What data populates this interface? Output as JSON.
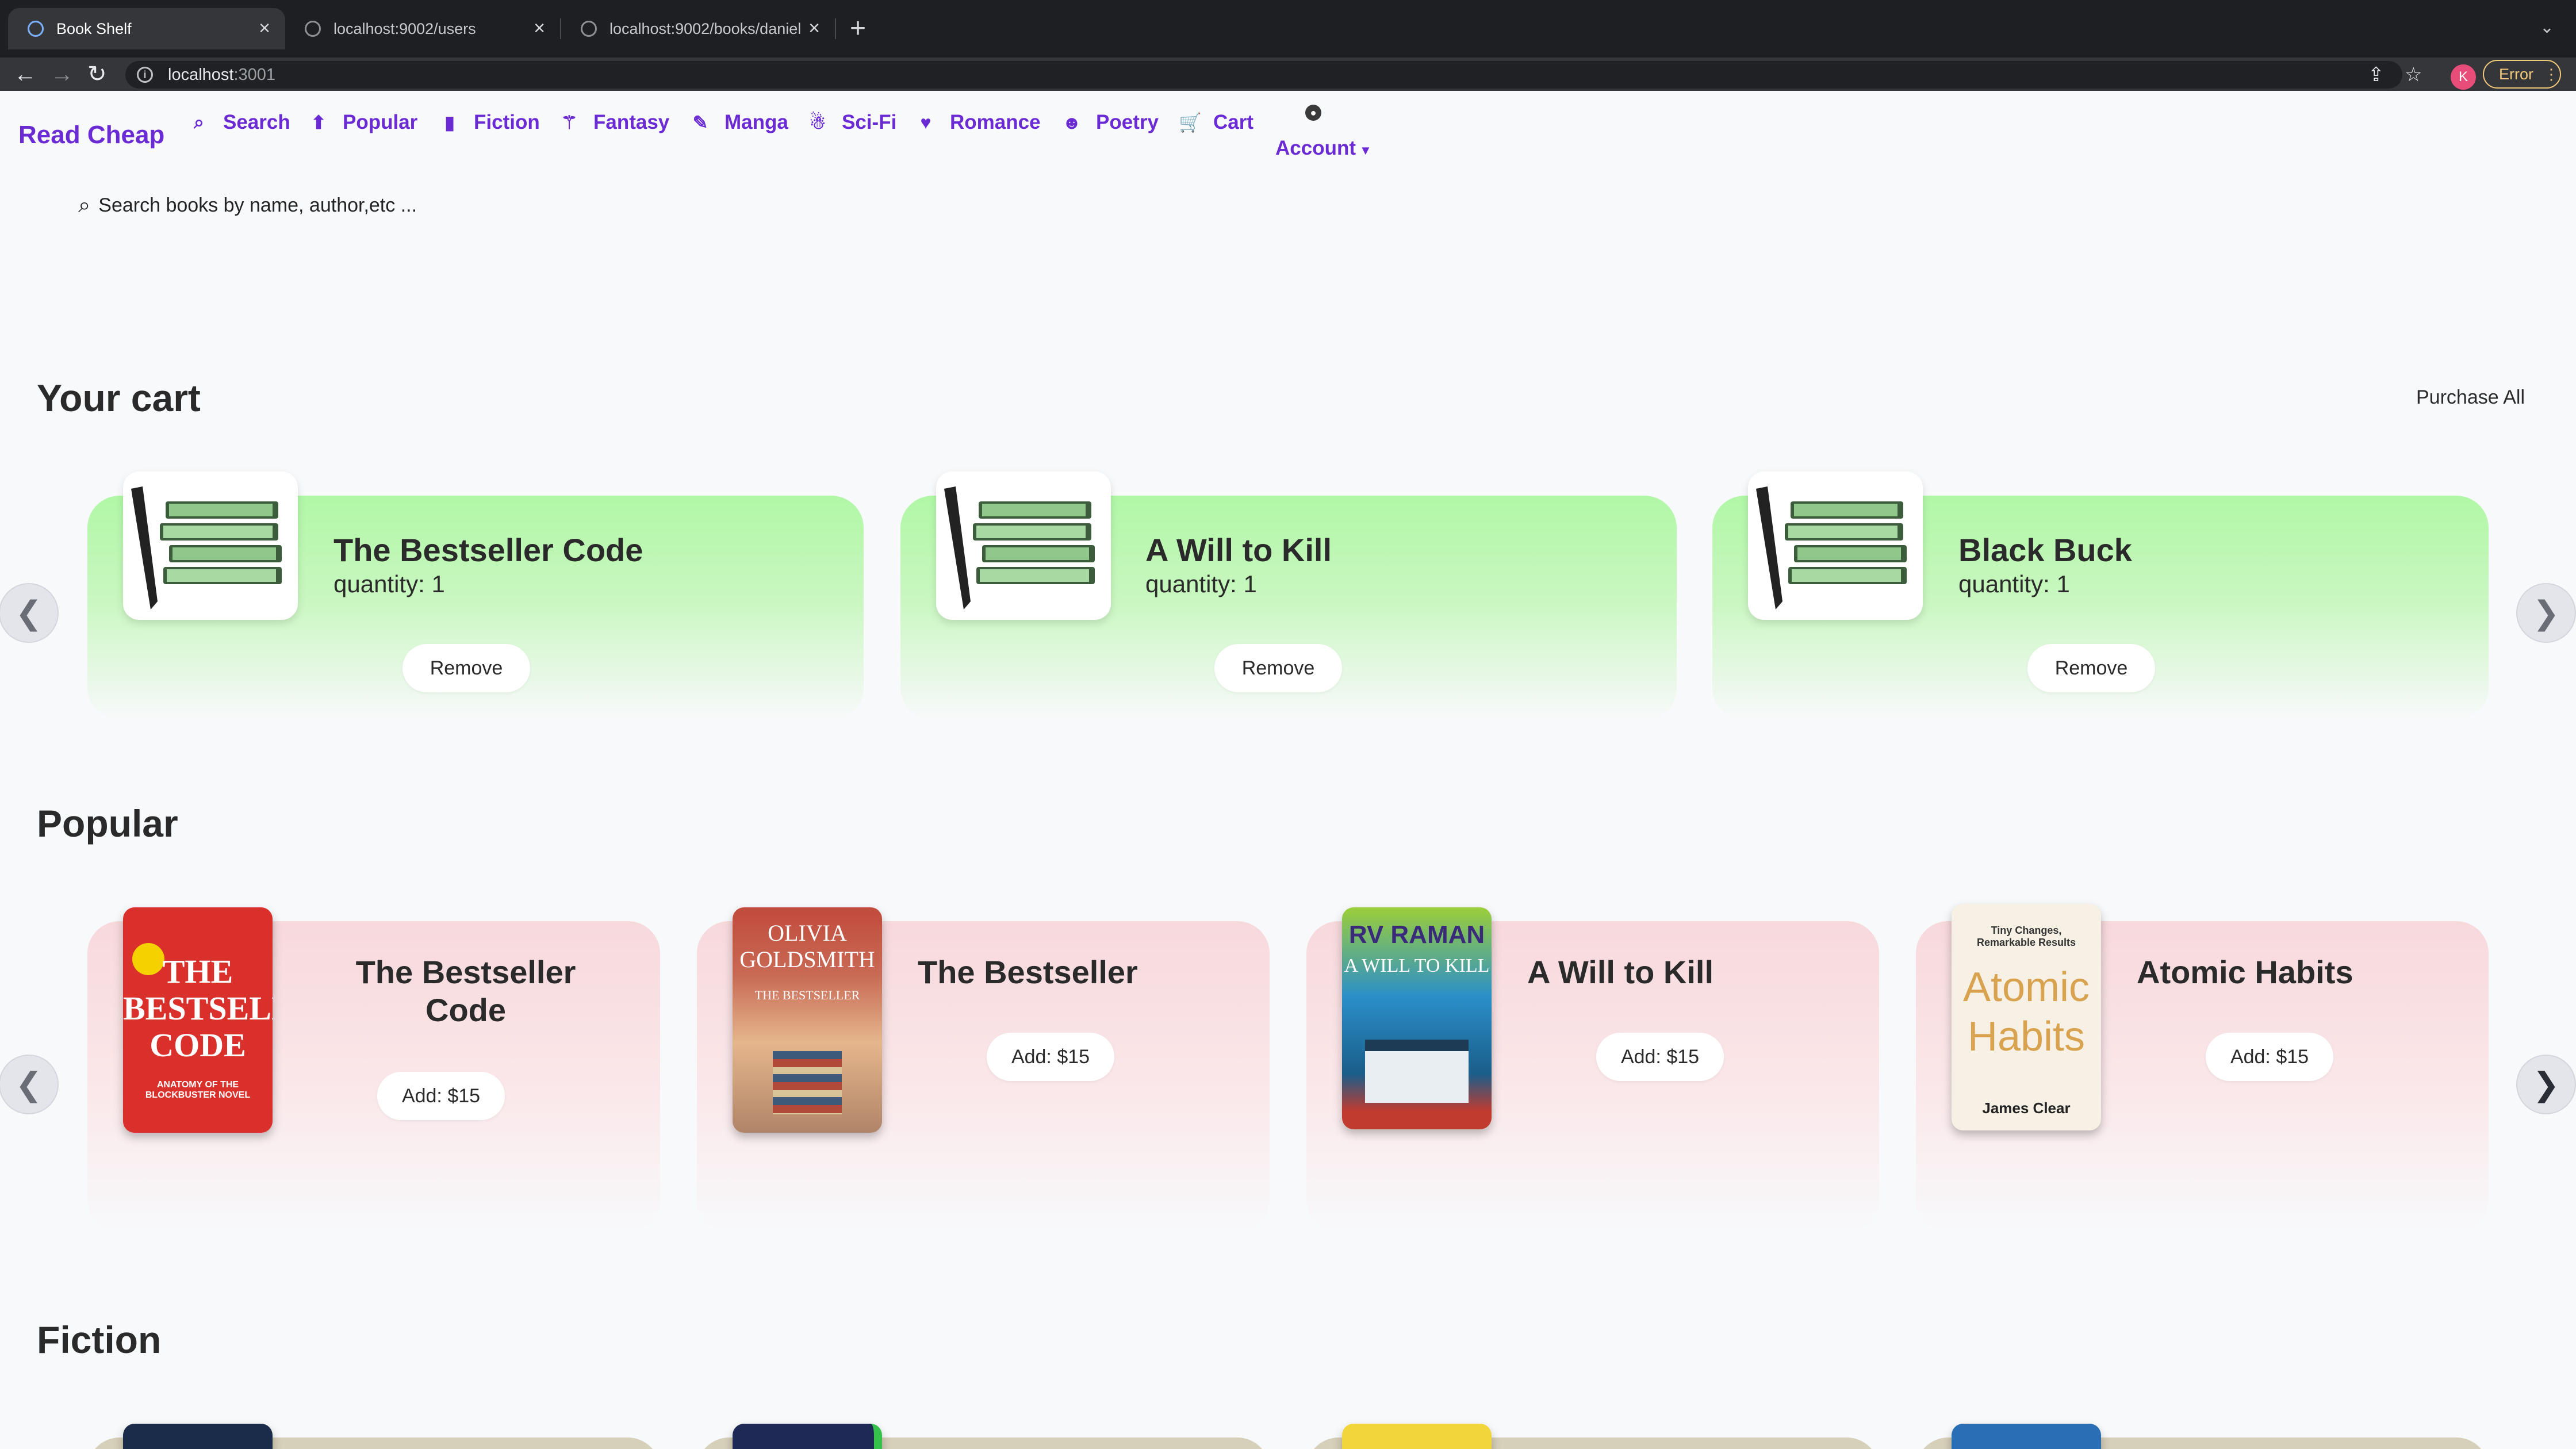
{
  "browser": {
    "tabs": [
      {
        "label": "Book Shelf",
        "active": true
      },
      {
        "label": "localhost:9002/users",
        "active": false
      },
      {
        "label": "localhost:9002/books/daniel",
        "active": false
      }
    ],
    "new_tab": "+",
    "close": "×",
    "url_host": "localhost",
    "url_port": ":3001",
    "avatar_letter": "K",
    "error_label": "Error"
  },
  "nav": {
    "brand": "Read Cheap",
    "items": [
      {
        "label": "Search",
        "icon": "search-icon"
      },
      {
        "label": "Popular",
        "icon": "arrow-up-circle-icon"
      },
      {
        "label": "Fiction",
        "icon": "book-icon"
      },
      {
        "label": "Fantasy",
        "icon": "wizard-icon"
      },
      {
        "label": "Manga",
        "icon": "feather-icon"
      },
      {
        "label": "Sci-Fi",
        "icon": "astronaut-icon"
      },
      {
        "label": "Romance",
        "icon": "heart-icon"
      },
      {
        "label": "Poetry",
        "icon": "smile-icon"
      },
      {
        "label": "Cart",
        "icon": "cart-icon"
      }
    ],
    "account": "Account"
  },
  "search": {
    "placeholder": "Search books by name, author,etc ..."
  },
  "cart": {
    "heading": "Your cart",
    "purchase_all": "Purchase All",
    "items": [
      {
        "title": "The Bestseller Code",
        "quantity": "quantity: 1",
        "remove": "Remove"
      },
      {
        "title": "A Will to Kill",
        "quantity": "quantity: 1",
        "remove": "Remove"
      },
      {
        "title": "Black Buck",
        "quantity": "quantity: 1",
        "remove": "Remove"
      }
    ]
  },
  "popular": {
    "heading": "Popular",
    "items": [
      {
        "title_line1": "The Bestseller",
        "title_line2": "Code",
        "add": "Add: $15",
        "cover_text": "THE BESTSELLER CODE",
        "cover_sub": "ANATOMY OF THE BLOCKBUSTER NOVEL"
      },
      {
        "title_line1": "The Bestseller",
        "title_line2": "",
        "add": "Add: $15",
        "cover_text": "OLIVIA GOLDSMITH",
        "cover_sub": "THE BESTSELLER"
      },
      {
        "title_line1": "A Will to Kill",
        "title_line2": "",
        "add": "Add: $15",
        "cover_text": "RV RAMAN",
        "cover_sub": "A WILL TO KILL"
      },
      {
        "title_line1": "Atomic Habits",
        "title_line2": "",
        "add": "Add: $15",
        "cover_text": "Atomic Habits",
        "cover_sub": "James Clear"
      }
    ]
  },
  "fiction": {
    "heading": "Fiction"
  },
  "arrows": {
    "prev": "❮",
    "next": "❯"
  },
  "colors": {
    "accent": "#6b2bd4",
    "cart_card": "#b1f7a7",
    "popular_card": "#f7d9dc"
  }
}
